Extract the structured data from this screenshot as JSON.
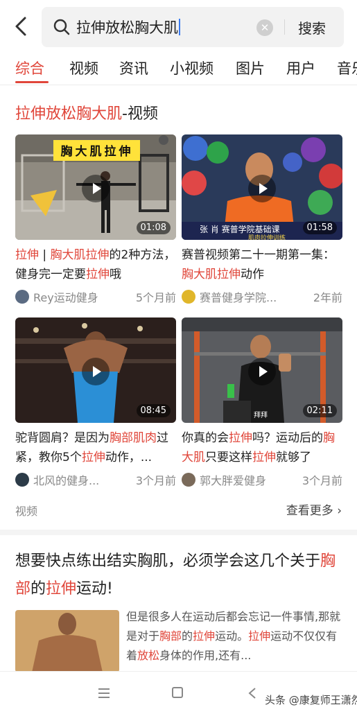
{
  "search": {
    "query": "拉伸放松胸大肌",
    "clear_icon": "clear-icon",
    "button": "搜索"
  },
  "tabs": [
    "综合",
    "视频",
    "资讯",
    "小视频",
    "图片",
    "用户",
    "音乐"
  ],
  "active_tab": "综合",
  "video_section": {
    "title_highlight": "拉伸放松胸大肌",
    "title_suffix": "-视频",
    "cards": [
      {
        "thumb_caption": "胸大肌拉伸",
        "duration": "01:08",
        "title_parts": [
          [
            "拉伸",
            true
          ],
          [
            " | ",
            false
          ],
          [
            "胸大肌拉伸",
            true
          ],
          [
            "的2种方法，健身完一定要",
            false
          ],
          [
            "拉伸",
            true
          ],
          [
            "哦",
            false
          ]
        ],
        "author": "Rey运动健身",
        "time": "5个月前"
      },
      {
        "thumb_caption": "张 肖    赛普学院基础课",
        "thumb_sub": "肌肉拉伸训练",
        "duration": "01:58",
        "title_parts": [
          [
            "赛普视频第二十一期第一集：",
            false
          ],
          [
            "胸大肌拉伸",
            true
          ],
          [
            "动作",
            false
          ]
        ],
        "author": "赛普健身学院...",
        "time": "2年前"
      },
      {
        "duration": "08:45",
        "title_parts": [
          [
            "驼背圆肩？是因为",
            false
          ],
          [
            "胸部肌肉",
            true
          ],
          [
            "过紧，教你5个",
            false
          ],
          [
            "拉伸",
            true
          ],
          [
            "动作，...",
            false
          ]
        ],
        "author": "北风的健身...",
        "time": "3个月前"
      },
      {
        "thumb_caption": "拜拜",
        "duration": "02:11",
        "title_parts": [
          [
            "你真的会",
            false
          ],
          [
            "拉伸",
            true
          ],
          [
            "吗？运动后的",
            false
          ],
          [
            "胸大肌",
            true
          ],
          [
            "只要这样",
            false
          ],
          [
            "拉伸",
            true
          ],
          [
            "就够了",
            false
          ]
        ],
        "author": "郭大胖爱健身",
        "time": "3个月前"
      }
    ],
    "footer_label": "视频",
    "more_link": "查看更多 ›"
  },
  "article": {
    "title_parts": [
      [
        "想要快点练出结实胸肌，必须学会这几个关于",
        false
      ],
      [
        "胸部",
        true
      ],
      [
        "的",
        false
      ],
      [
        "拉伸",
        true
      ],
      [
        "运动!",
        false
      ]
    ],
    "snippet_parts": [
      [
        "但是很多人在运动后都会忘记一件事情,那就是对于",
        false
      ],
      [
        "胸部",
        true
      ],
      [
        "的",
        false
      ],
      [
        "拉伸",
        true
      ],
      [
        "运动。",
        false
      ],
      [
        "拉伸",
        true
      ],
      [
        "运动不仅仅有着",
        false
      ],
      [
        "放松",
        true
      ],
      [
        "身体的作用,还有...",
        false
      ]
    ]
  },
  "navbar": {
    "watermark": "头条 @康复师王潇然"
  },
  "colors": {
    "accent": "#e0463a",
    "muted": "#888888"
  }
}
